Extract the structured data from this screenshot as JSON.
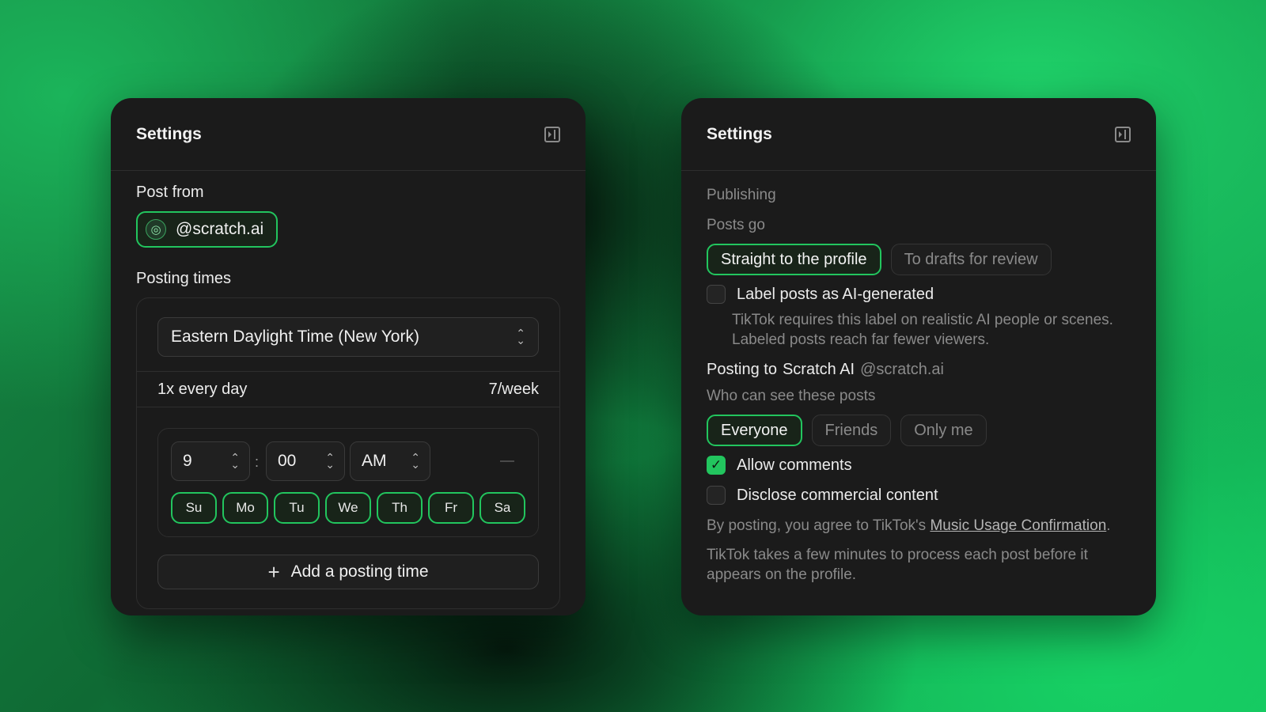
{
  "colors": {
    "accent": "#22c55e",
    "panel": "#1b1b1b",
    "muted": "#8a8a8a"
  },
  "left": {
    "title": "Settings",
    "collapse_icon": "sidebar-collapse-icon",
    "post_from_label": "Post from",
    "account_icon": "globe-icon",
    "account_handle": "@scratch.ai",
    "posting_times_label": "Posting times",
    "timezone": "Eastern Daylight Time (New York)",
    "frequency": "1x every day",
    "per_week": "7/week",
    "slot": {
      "hour": "9",
      "minute": "00",
      "ampm": "AM",
      "days": [
        "Su",
        "Mo",
        "Tu",
        "We",
        "Th",
        "Fr",
        "Sa"
      ]
    },
    "add_label": "Add a posting time"
  },
  "right": {
    "title": "Settings",
    "collapse_icon": "sidebar-collapse-icon",
    "publishing_label": "Publishing",
    "posts_go_label": "Posts go",
    "posts_go_options": [
      "Straight to the profile",
      "To drafts for review"
    ],
    "posts_go_selected": "Straight to the profile",
    "ai_label": {
      "text": "Label posts as AI-generated",
      "checked": false
    },
    "ai_helper": "TikTok requires this label on realistic AI people or scenes. Labeled posts reach far fewer viewers.",
    "posting_to_prefix": "Posting to",
    "posting_to_name": "Scratch AI",
    "posting_to_handle": "@scratch.ai",
    "visibility_label": "Who can see these posts",
    "visibility_options": [
      "Everyone",
      "Friends",
      "Only me"
    ],
    "visibility_selected": "Everyone",
    "allow_comments": {
      "text": "Allow comments",
      "checked": true
    },
    "disclose": {
      "text": "Disclose commercial content",
      "checked": false
    },
    "agree_prefix": "By posting, you agree to TikTok's ",
    "agree_link": "Music Usage Confirmation",
    "agree_suffix": ".",
    "process_note": "TikTok takes a few minutes to process each post before it appears on the profile."
  }
}
